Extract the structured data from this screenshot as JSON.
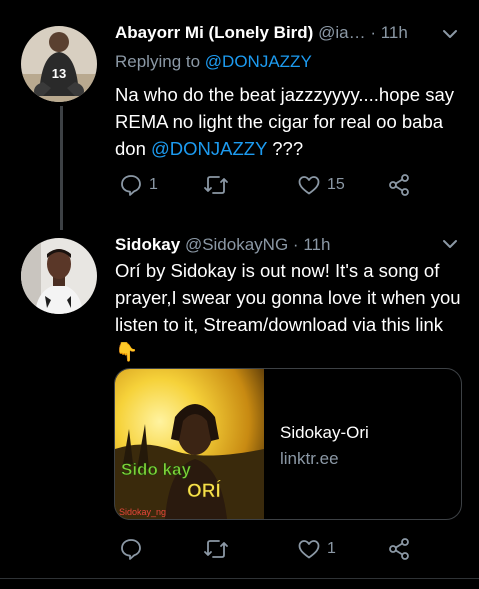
{
  "tweets": [
    {
      "author_name": "Abayorr Mi (Lonely Bird)",
      "handle": "@ia…",
      "separator": "·",
      "time": "11h",
      "replying_to_label": "Replying to",
      "replying_to_user": "@DONJAZZY",
      "text_before_mention": "Na who do the beat jazzzyyyy....hope say REMA no light the cigar for real oo baba don ",
      "mention": "@DONJAZZY",
      "text_after_mention": " ???",
      "reply_count": "1",
      "like_count": "15",
      "avatar_jersey_number": "13"
    },
    {
      "author_name": "Sidokay",
      "handle": "@SidokayNG",
      "separator": "·",
      "time": "11h",
      "text": "Orí by Sidokay is out now! It's a song of prayer,I swear you gonna love it when you listen to it, Stream/download via this link",
      "emoji": "👇",
      "like_count": "1",
      "card": {
        "title": "Sidokay-Ori",
        "domain": "linktr.ee",
        "art_line1": "Sido kay",
        "art_line2": "ORÍ",
        "art_handle": "Sidokay_ng"
      }
    }
  ],
  "icons": [
    "chevron-down-icon",
    "reply-icon",
    "retweet-icon",
    "like-icon",
    "share-icon"
  ],
  "colors": {
    "background": "#000000",
    "muted": "#8b98a5",
    "link": "#1d9bf0",
    "border": "#3d4145"
  }
}
